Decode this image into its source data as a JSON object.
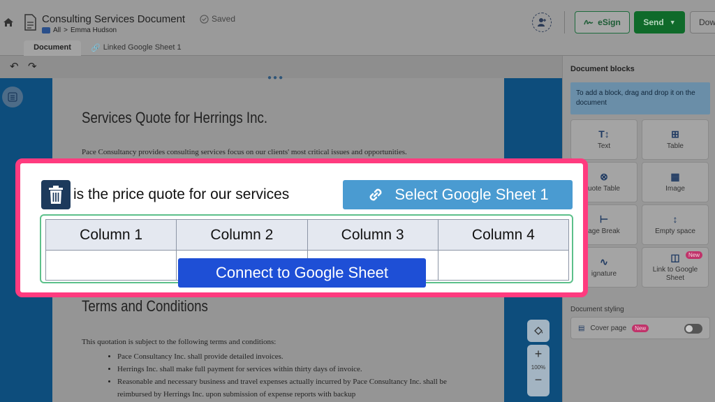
{
  "header": {
    "title": "Consulting Services Document",
    "saved_label": "Saved",
    "breadcrumb": {
      "root": "All",
      "separator": ">",
      "owner": "Emma Hudson"
    },
    "esign_label": "eSign",
    "send_label": "Send",
    "download_label": "Dow"
  },
  "tabs": [
    {
      "label": "Document",
      "active": true
    },
    {
      "label": "Linked Google Sheet 1",
      "active": false
    }
  ],
  "document": {
    "heading": "Services Quote for Herrings Inc.",
    "intro": "Pace Consultancy provides consulting services focus on our clients' most critical issues and opportunities.",
    "terms_heading": "Terms and Conditions",
    "terms_intro": "This quotation is subject to the following terms and conditions:",
    "terms": [
      "Pace Consultancy Inc. shall provide detailed invoices.",
      "Herrings Inc. shall make full payment for services within thirty days of invoice.",
      "Reasonable and necessary business and travel expenses actually incurred by Pace Consultancy Inc. shall be reimbursed by Herrings Inc. upon submission of expense reports with backup"
    ],
    "zoom": {
      "plus": "+",
      "percent": "100%",
      "minus": "−"
    }
  },
  "spotlight": {
    "quote_text": "is the price quote for our services",
    "select_sheet_label": "Select Google Sheet 1",
    "columns": [
      "Column 1",
      "Column 2",
      "Column 3",
      "Column 4"
    ],
    "connect_label": "Connect to Google Sheet"
  },
  "panel": {
    "title": "Document blocks",
    "hint": "To add a block, drag and drop it on the document",
    "blocks": [
      {
        "label": "Text",
        "icon": "text-icon"
      },
      {
        "label": "Table",
        "icon": "table-icon"
      },
      {
        "label": "uote Table",
        "icon": "quote-table-icon"
      },
      {
        "label": "Image",
        "icon": "image-icon"
      },
      {
        "label": "age Break",
        "icon": "page-break-icon"
      },
      {
        "label": "Empty space",
        "icon": "empty-space-icon"
      },
      {
        "label": "ignature",
        "icon": "signature-icon"
      },
      {
        "label": "Link to Google Sheet",
        "icon": "sheet-icon",
        "badge": "New"
      }
    ],
    "styling_title": "Document styling",
    "cover_page_label": "Cover page",
    "cover_badge": "New"
  },
  "colors": {
    "spotlight_border": "#ff3b7f",
    "select_button": "#4a9bd1",
    "connect_button": "#1e4fd6",
    "send_button": "#0f6a2a",
    "table_outline": "#5cc08a"
  }
}
